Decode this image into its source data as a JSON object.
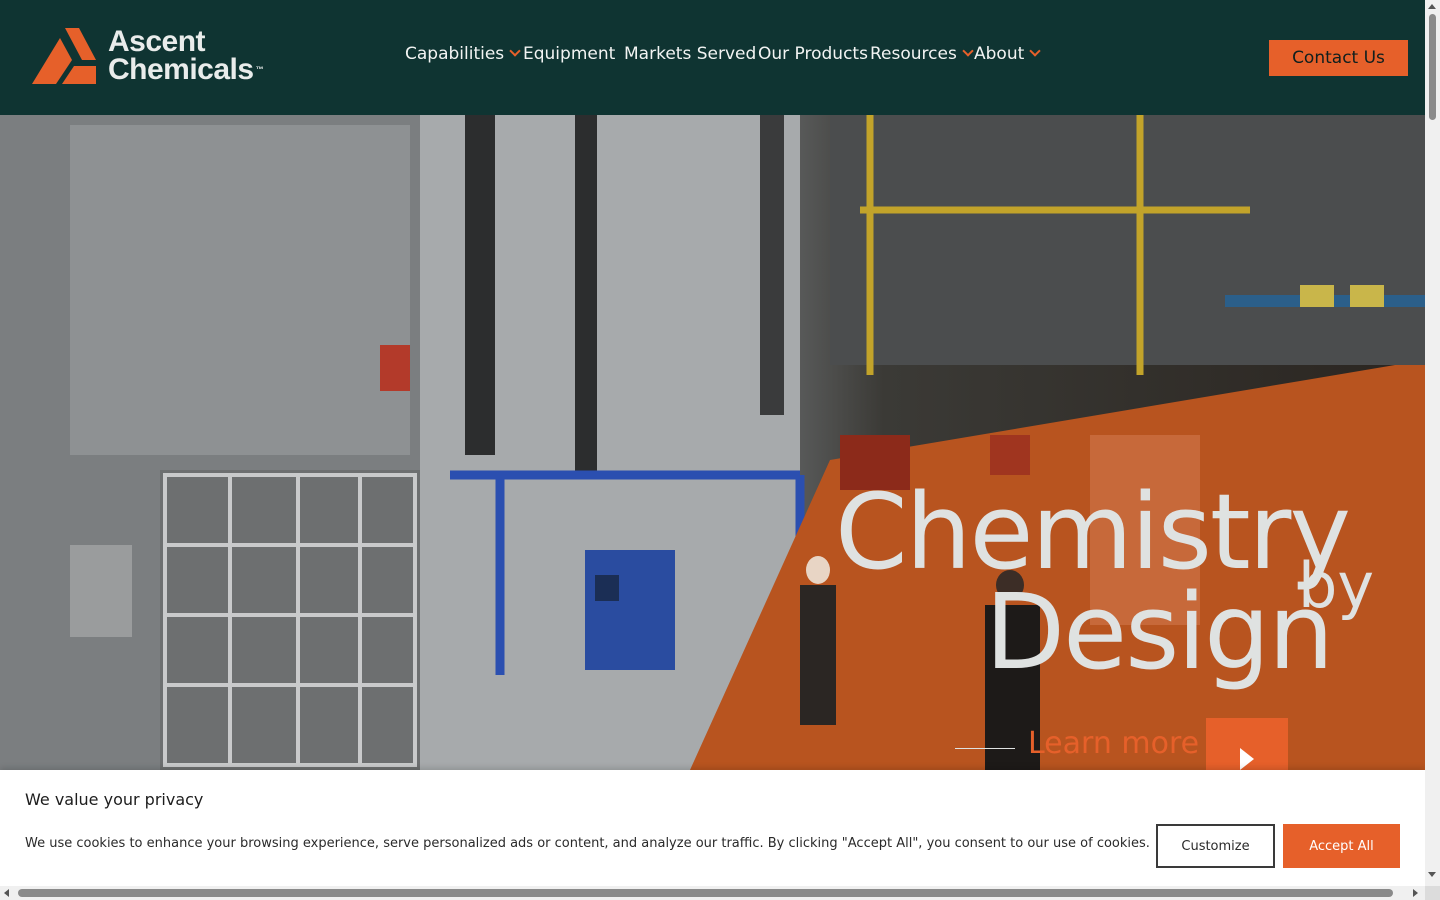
{
  "brand": {
    "name_line1": "Ascent",
    "name_line2": "Chemicals",
    "trademark": "™",
    "colors": {
      "header_bg": "#0f3432",
      "accent": "#e6602a",
      "text_light": "#dfe2e1"
    }
  },
  "nav": {
    "items": [
      {
        "label": "Capabilities",
        "has_dropdown": true
      },
      {
        "label": "Equipment",
        "has_dropdown": false
      },
      {
        "label": "Markets Served",
        "has_dropdown": false
      },
      {
        "label": "Our Products",
        "has_dropdown": false
      },
      {
        "label": "Resources",
        "has_dropdown": true
      },
      {
        "label": "About",
        "has_dropdown": true
      }
    ],
    "cta": "Contact Us"
  },
  "hero": {
    "headline_word1": "Chemistry",
    "headline_word2": "by",
    "headline_word3": "Design",
    "cta_label": "Learn more",
    "cta_icon": "play-arrow-icon"
  },
  "cookie_banner": {
    "title": "We value your privacy",
    "text": "We use cookies to enhance your browsing experience, serve personalized ads or content, and analyze our traffic. By clicking \"Accept All\", you consent to our use of cookies.",
    "customize_label": "Customize",
    "accept_label": "Accept All"
  }
}
